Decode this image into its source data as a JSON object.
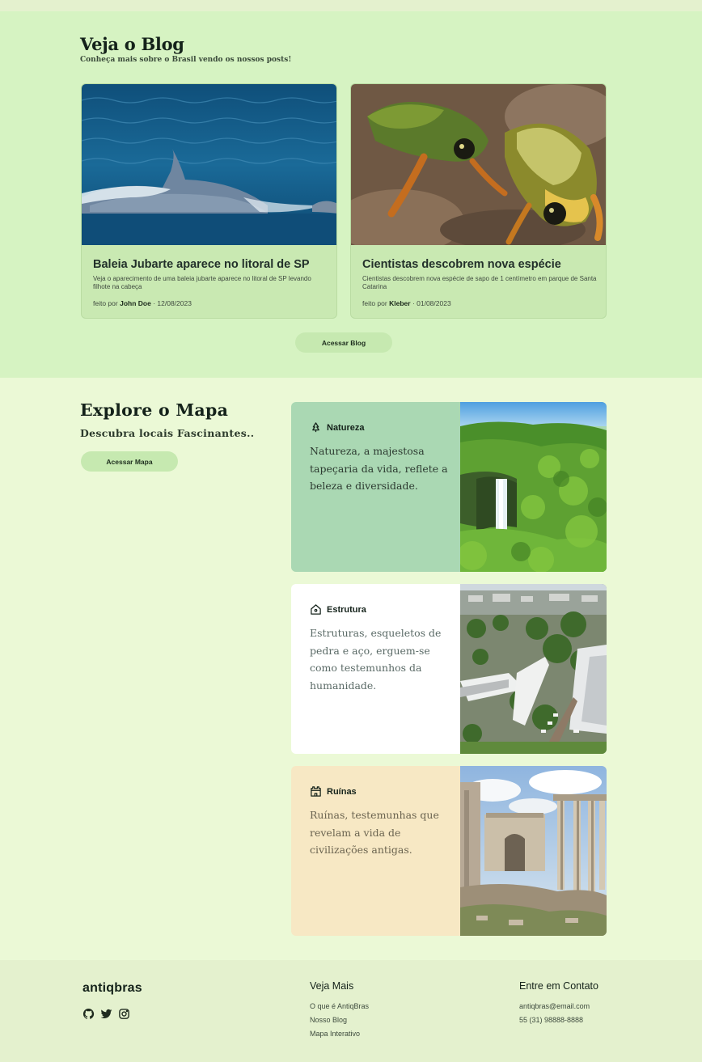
{
  "blog": {
    "title": "Veja o Blog",
    "subtitle": "Conheça mais sobre o Brasil vendo os nossos posts!",
    "button_label": "Acessar Blog",
    "posts": [
      {
        "title": "Baleia Jubarte aparece no litoral de SP",
        "description": "Veja o aparecimento de uma baleia jubarte aparece no litoral de SP levando filhote na cabeça",
        "by_prefix": "feito por",
        "author": "John Doe",
        "date": "· 12/08/2023",
        "image": "humpback-whale-photo"
      },
      {
        "title": "Cientistas descobrem nova espécie",
        "description": "Cientistas descobrem nova espécie de sapo de 1 centímetro em parque de Santa Catarina",
        "by_prefix": "feito por",
        "author": "Kleber",
        "date": "· 01/08/2023",
        "image": "frog-photo"
      }
    ]
  },
  "explore": {
    "title": "Explore o Mapa",
    "subtitle": "Descubra locais Fascinantes..",
    "button_label": "Acessar Mapa",
    "features": [
      {
        "label": "Natureza",
        "icon": "tree-icon",
        "text": "Natureza, a majestosa tapeçaria da vida, reflete a beleza e diversidade.",
        "bg": "#aad8b3",
        "image": "waterfall-photo"
      },
      {
        "label": "Estrutura",
        "icon": "home-icon",
        "text": "Estruturas, esqueletos de pedra e aço, erguem-se como testemunhos da humanidade.",
        "bg": "#ffffff",
        "image": "city-aerial-photo"
      },
      {
        "label": "Ruínas",
        "icon": "castle-icon",
        "text": "Ruínas, testemunhas que revelam a vida de civilizações antigas.",
        "bg": "#f7e8c4",
        "image": "roman-ruins-photo"
      }
    ]
  },
  "footer": {
    "brand": "antiqbras",
    "socials": [
      "github-icon",
      "twitter-icon",
      "instagram-icon"
    ],
    "col1": {
      "title": "Veja Mais",
      "links": [
        "O que é AntiqBras",
        "Nosso Blog",
        "Mapa Interativo"
      ]
    },
    "col2": {
      "title": "Entre em Contato",
      "items": [
        "antiqbras@email.com",
        "55 (31) 98888-8888"
      ]
    }
  },
  "colors": {
    "blog_bg": "#d6f3c2",
    "explore_bg": "#ebf9d6",
    "footer_bg": "#e4f1ce",
    "button_bg": "#c6e9b0"
  }
}
